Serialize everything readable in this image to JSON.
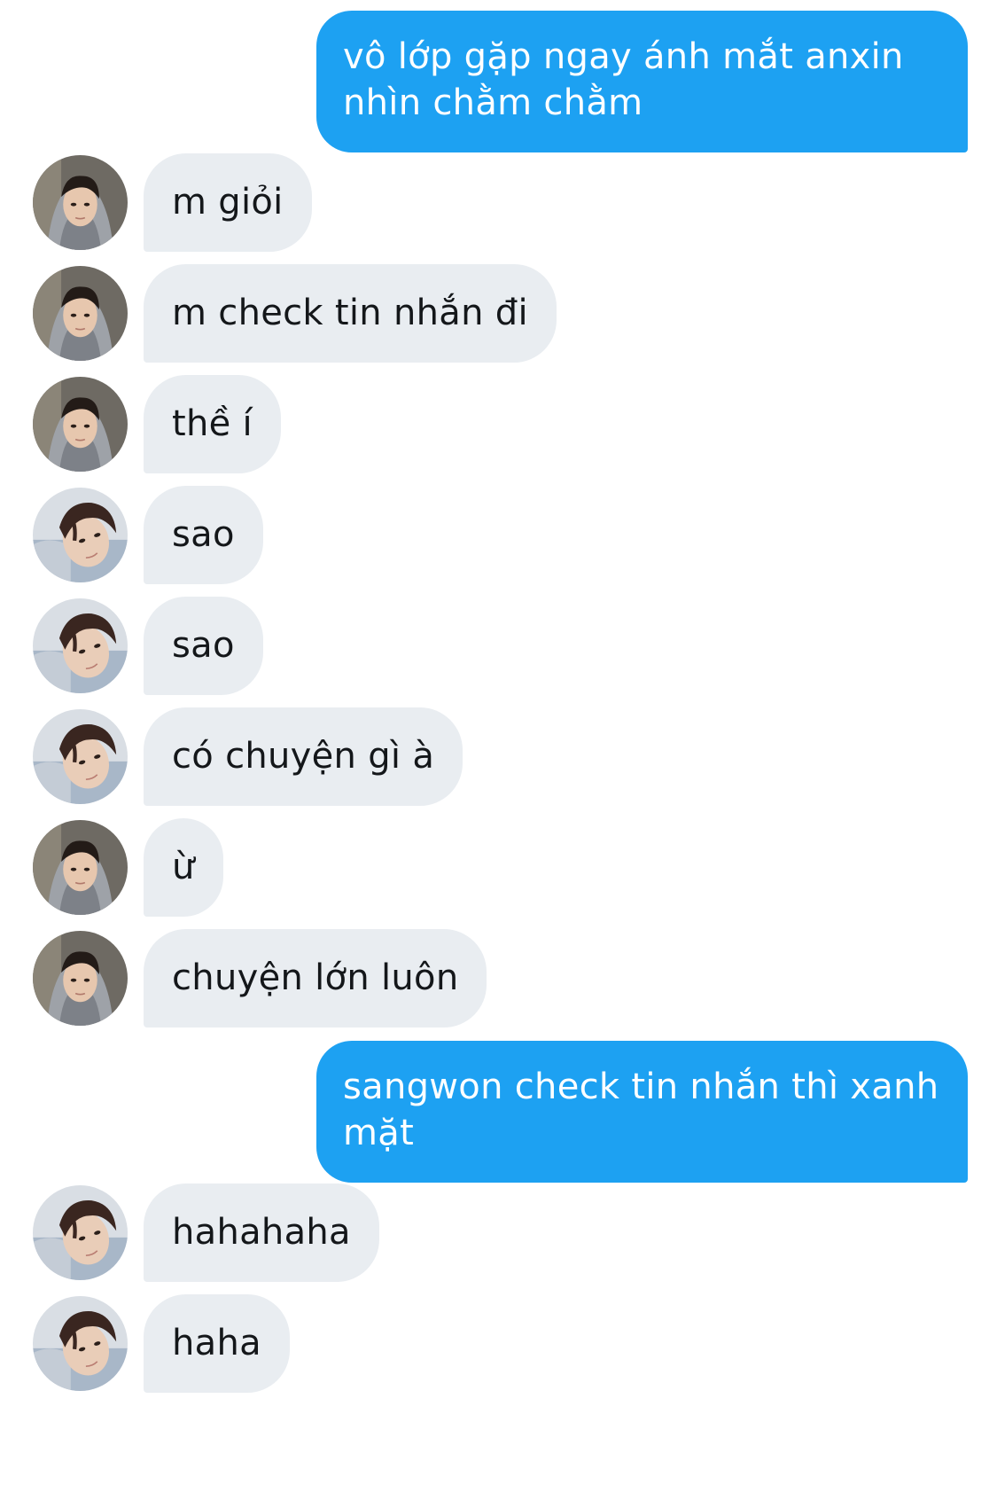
{
  "colors": {
    "outgoing_bubble": "#1da1f2",
    "incoming_bubble": "#e9edf1",
    "outgoing_text": "#ffffff",
    "incoming_text": "#14171a",
    "background": "#ffffff"
  },
  "avatars": {
    "a": "user-avatar-hooded",
    "b": "user-avatar-selfie"
  },
  "messages": [
    {
      "direction": "outgoing",
      "text": "vô lớp gặp ngay ánh mắt anxin nhìn chằm chằm"
    },
    {
      "direction": "incoming",
      "avatar": "a",
      "text": "m giỏi"
    },
    {
      "direction": "incoming",
      "avatar": "a",
      "text": "m check tin nhắn đi"
    },
    {
      "direction": "incoming",
      "avatar": "a",
      "text": "thề í"
    },
    {
      "direction": "incoming",
      "avatar": "b",
      "text": "sao"
    },
    {
      "direction": "incoming",
      "avatar": "b",
      "text": "sao"
    },
    {
      "direction": "incoming",
      "avatar": "b",
      "text": "có chuyện gì à"
    },
    {
      "direction": "incoming",
      "avatar": "a",
      "text": "ừ"
    },
    {
      "direction": "incoming",
      "avatar": "a",
      "text": "chuyện lớn luôn"
    },
    {
      "direction": "outgoing",
      "text": "sangwon check tin nhắn thì xanh mặt"
    },
    {
      "direction": "incoming",
      "avatar": "b",
      "text": "hahahaha"
    },
    {
      "direction": "incoming",
      "avatar": "b",
      "text": "haha"
    }
  ]
}
